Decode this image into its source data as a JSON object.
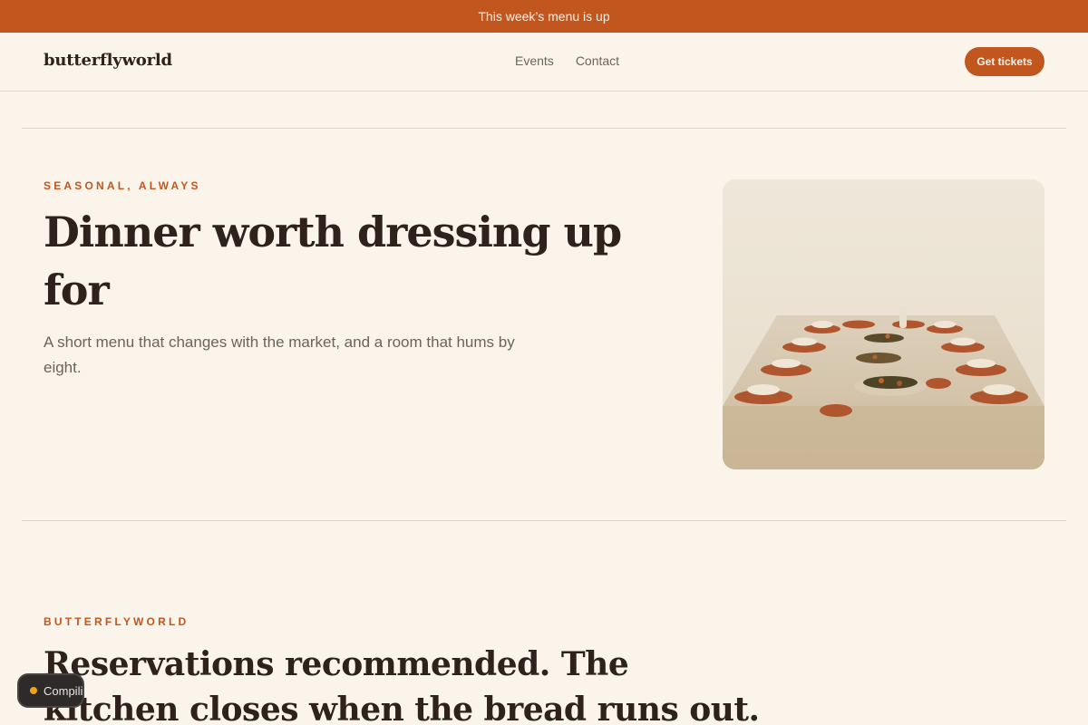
{
  "announcement": "This week’s menu is up",
  "brand": {
    "name": "butterflyworld"
  },
  "nav": {
    "links": [
      "Events",
      "Contact"
    ],
    "cta": "Get tickets"
  },
  "hero": {
    "eyebrow": "Seasonal, always",
    "title": "Dinner worth dressing up for",
    "subtitle": "A short menu that changes with the market, and a room that hums by eight.",
    "image_icon": "dinner-table-image"
  },
  "section": {
    "eyebrow": "butterflyworld",
    "title": "Reservations recommended. The kitchen closes when the bread runs out."
  },
  "status_pill": {
    "label": "Compiling",
    "dot_color": "#f0a21a"
  },
  "colors": {
    "accent": "#c2561f",
    "background": "#fbf4ea",
    "text": "#2f211b"
  }
}
